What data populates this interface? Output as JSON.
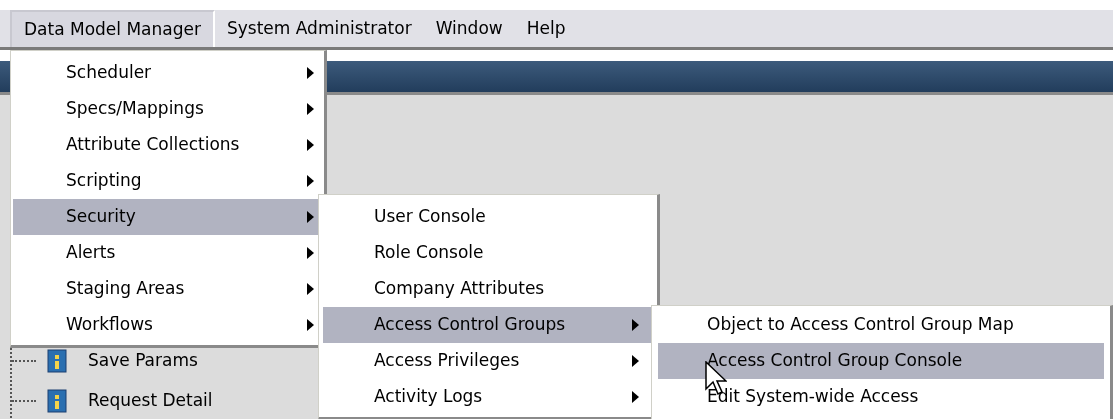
{
  "menu_bar": [
    {
      "label": "Data Model Manager",
      "selected": true
    },
    {
      "label": "System Administrator",
      "selected": false
    },
    {
      "label": "Window",
      "selected": false
    },
    {
      "label": "Help",
      "selected": false
    }
  ],
  "tree_items": [
    {
      "label": "Save Params"
    },
    {
      "label": "Request Detail"
    }
  ],
  "menus": [
    {
      "items": [
        {
          "label": "Scheduler",
          "has_submenu": true,
          "selected": false
        },
        {
          "label": "Specs/Mappings",
          "has_submenu": true,
          "selected": false
        },
        {
          "label": "Attribute Collections",
          "has_submenu": true,
          "selected": false
        },
        {
          "label": "Scripting",
          "has_submenu": true,
          "selected": false
        },
        {
          "label": "Security",
          "has_submenu": true,
          "selected": true
        },
        {
          "label": "Alerts",
          "has_submenu": true,
          "selected": false
        },
        {
          "label": "Staging Areas",
          "has_submenu": true,
          "selected": false
        },
        {
          "label": "Workflows",
          "has_submenu": true,
          "selected": false
        }
      ]
    },
    {
      "items": [
        {
          "label": "User Console",
          "has_submenu": false,
          "selected": false
        },
        {
          "label": "Role Console",
          "has_submenu": false,
          "selected": false
        },
        {
          "label": "Company Attributes",
          "has_submenu": false,
          "selected": false
        },
        {
          "label": "Access Control Groups",
          "has_submenu": true,
          "selected": true
        },
        {
          "label": "Access Privileges",
          "has_submenu": true,
          "selected": false
        },
        {
          "label": "Activity Logs",
          "has_submenu": true,
          "selected": false
        }
      ]
    },
    {
      "items": [
        {
          "label": "Object to Access Control Group Map",
          "has_submenu": false,
          "selected": false
        },
        {
          "label": "Access Control Group Console",
          "has_submenu": false,
          "selected": true
        },
        {
          "label": "Edit System-wide Access",
          "has_submenu": false,
          "selected": false
        }
      ]
    }
  ]
}
